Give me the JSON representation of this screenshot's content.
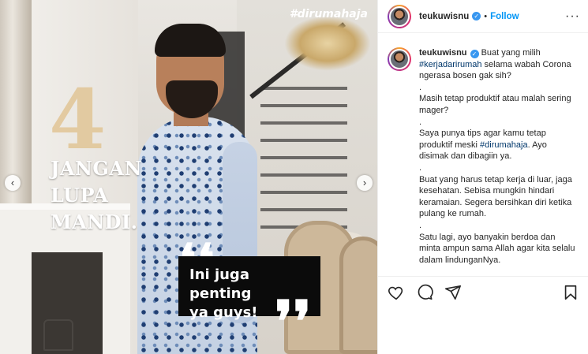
{
  "media": {
    "hashtag": "#dirumahaja",
    "big_number": "4",
    "headline": "JANGAN LUPA\nMANDI.",
    "quote": "Ini juga penting\nya guys!",
    "quote_open": "❛❛",
    "quote_close": "❜❜",
    "prev_icon": "chevron-left-icon",
    "next_icon": "chevron-right-icon"
  },
  "header": {
    "username": "teukuwisnu",
    "separator": "•",
    "follow_label": "Follow",
    "more_label": "···"
  },
  "caption": {
    "username": "teukuwisnu",
    "intro_before": "Buat yang milih ",
    "intro_tag": "#kerjadarirumah",
    "intro_after": " selama wabah Corona ngerasa bosen gak sih?",
    "dot1": ".",
    "line2": "Masih tetap produktif atau malah sering mager?",
    "dot2": ".",
    "line3_before": "Saya punya tips agar kamu tetap produktif meski ",
    "line3_tag": "#dirumahaja",
    "line3_after": ". Ayo disimak dan dibagiin ya.",
    "dot3": ".",
    "line4": "Buat yang harus tetap kerja di luar, jaga kesehatan. Sebisa mungkin hindari keramaian. Segera bersihkan diri ketika pulang ke rumah.",
    "dot4": ".",
    "line5": "Satu lagi, ayo banyakin berdoa dan minta ampun sama Allah agar kita selalu dalam lindunganNya."
  },
  "actions": {
    "like_icon": "heart-icon",
    "comment_icon": "comment-icon",
    "share_icon": "share-icon",
    "save_icon": "bookmark-icon"
  },
  "colors": {
    "accent": "#0095f6",
    "verified": "#3897f0",
    "hashtag_link": "#00376b",
    "number_gold": "#e2c79a"
  }
}
